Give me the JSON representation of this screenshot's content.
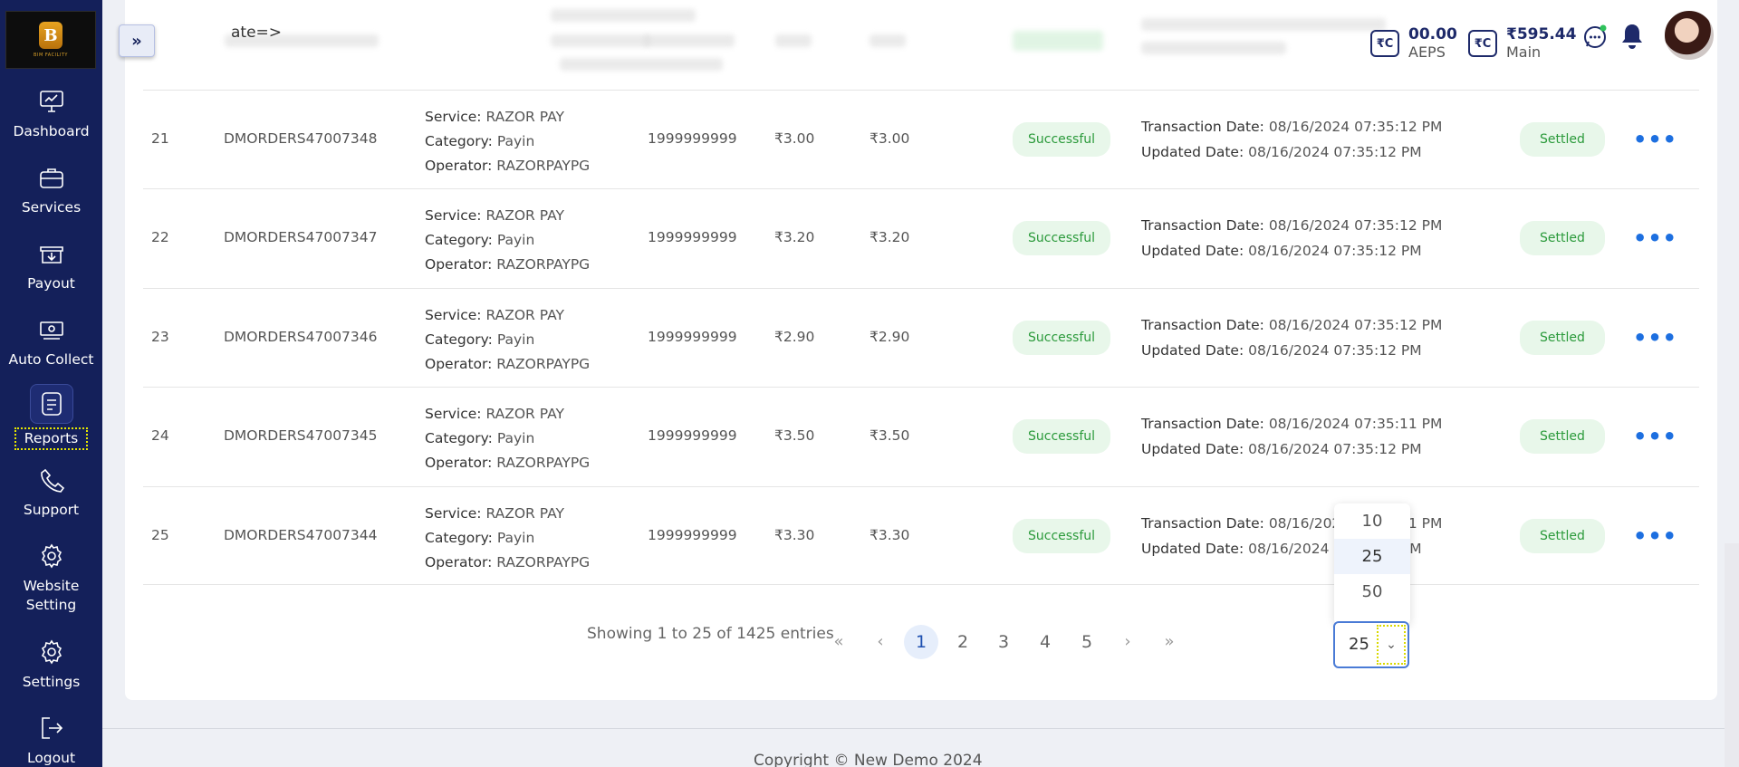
{
  "header": {
    "menu_toggle": "»",
    "date_fragment": "ate=>",
    "wallets": [
      {
        "icon": "₹C",
        "amount": "00.00",
        "name": "AEPS"
      },
      {
        "icon": "₹C",
        "amount": "₹595.44",
        "name": "Main"
      }
    ]
  },
  "sidebar": {
    "logo_letter": "B",
    "logo_tag": "BIM FACILITY",
    "items": [
      {
        "label": "Dashboard",
        "icon": "monitor-icon"
      },
      {
        "label": "Services",
        "icon": "briefcase-icon"
      },
      {
        "label": "Payout",
        "icon": "download-box-icon"
      },
      {
        "label": "Auto Collect",
        "icon": "banknote-icon"
      },
      {
        "label": "Reports",
        "icon": "report-icon",
        "active": true
      },
      {
        "label": "Support",
        "icon": "phone-icon"
      },
      {
        "label": "Website Setting",
        "icon": "gear-icon"
      },
      {
        "label": "Settings",
        "icon": "gear-icon"
      },
      {
        "label": "Logout",
        "icon": "logout-icon"
      }
    ]
  },
  "table": {
    "service_label": "Service:",
    "category_label": "Category:",
    "operator_label": "Operator:",
    "txn_date_label": "Transaction Date:",
    "upd_date_label": "Updated Date:",
    "rows": [
      {
        "num": "21",
        "order_id": "DMORDERS47007348",
        "service": "RAZOR PAY",
        "category": "Payin",
        "operator": "RAZORPAYPG",
        "phone": "1999999999",
        "amount": "₹3.00",
        "net": "₹3.00",
        "status": "Successful",
        "txn_date": "08/16/2024 07:35:12 PM",
        "upd_date": "08/16/2024 07:35:12 PM",
        "settle": "Settled"
      },
      {
        "num": "22",
        "order_id": "DMORDERS47007347",
        "service": "RAZOR PAY",
        "category": "Payin",
        "operator": "RAZORPAYPG",
        "phone": "1999999999",
        "amount": "₹3.20",
        "net": "₹3.20",
        "status": "Successful",
        "txn_date": "08/16/2024 07:35:12 PM",
        "upd_date": "08/16/2024 07:35:12 PM",
        "settle": "Settled"
      },
      {
        "num": "23",
        "order_id": "DMORDERS47007346",
        "service": "RAZOR PAY",
        "category": "Payin",
        "operator": "RAZORPAYPG",
        "phone": "1999999999",
        "amount": "₹2.90",
        "net": "₹2.90",
        "status": "Successful",
        "txn_date": "08/16/2024 07:35:12 PM",
        "upd_date": "08/16/2024 07:35:12 PM",
        "settle": "Settled"
      },
      {
        "num": "24",
        "order_id": "DMORDERS47007345",
        "service": "RAZOR PAY",
        "category": "Payin",
        "operator": "RAZORPAYPG",
        "phone": "1999999999",
        "amount": "₹3.50",
        "net": "₹3.50",
        "status": "Successful",
        "txn_date": "08/16/2024 07:35:11 PM",
        "upd_date": "08/16/2024 07:35:12 PM",
        "settle": "Settled"
      },
      {
        "num": "25",
        "order_id": "DMORDERS47007344",
        "service": "RAZOR PAY",
        "category": "Payin",
        "operator": "RAZORPAYPG",
        "phone": "1999999999",
        "amount": "₹3.30",
        "net": "₹3.30",
        "status": "Successful",
        "txn_date": "08/16/2024 07:35:11 PM",
        "upd_date": "08/16/2024 07:35:12 PM",
        "settle": "Settled"
      }
    ],
    "more_label": "•••"
  },
  "pagination": {
    "summary": "Showing 1 to 25 of 1425 entries",
    "first": "«",
    "prev": "‹",
    "pages": [
      "1",
      "2",
      "3",
      "4",
      "5"
    ],
    "next": "›",
    "last": "»",
    "per_page": "25",
    "per_page_options": [
      "10",
      "25",
      "50"
    ]
  },
  "footer": {
    "copyright": "Copyright © New Demo 2024"
  }
}
